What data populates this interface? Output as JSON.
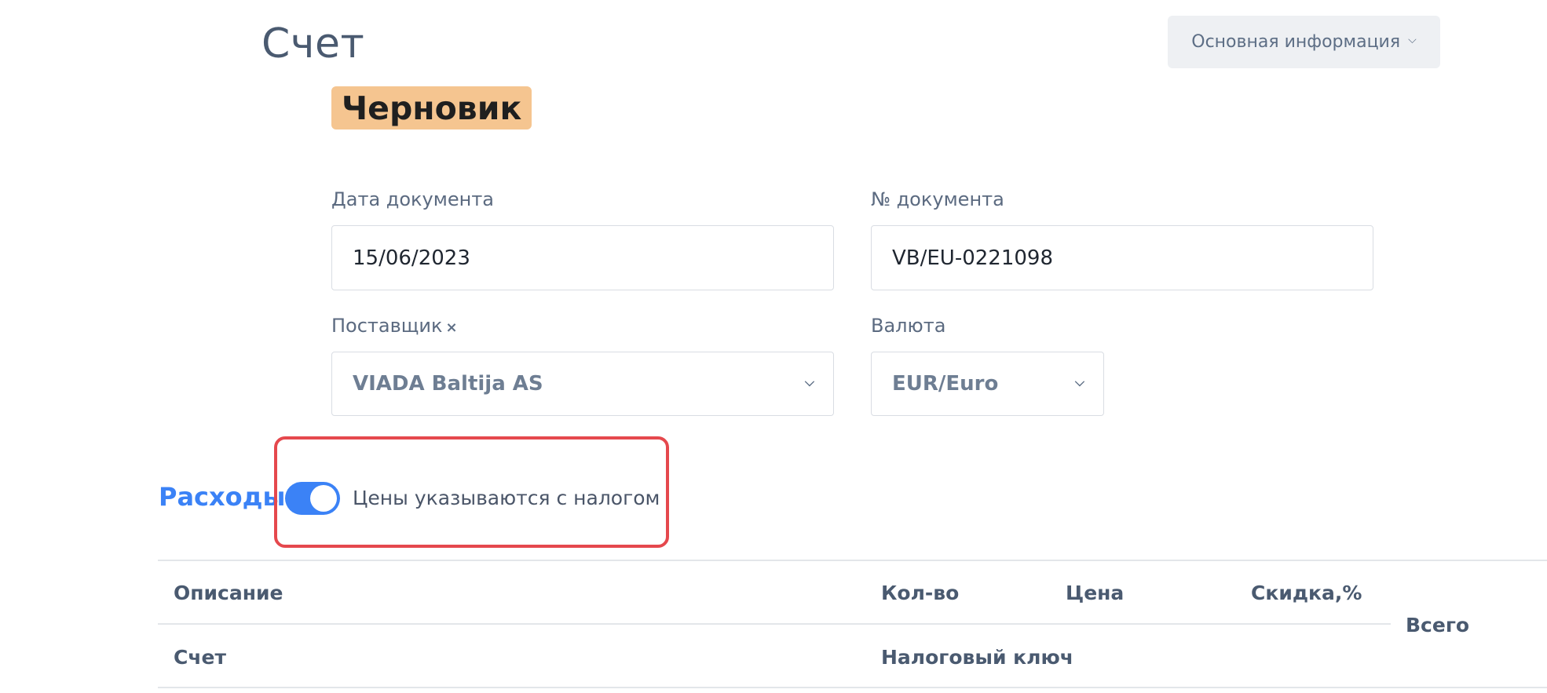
{
  "page": {
    "title": "Счет",
    "status_badge": "Черновик",
    "section_menu": {
      "label": "Основная информация",
      "icon": "chevron-down-icon"
    }
  },
  "form": {
    "document_date": {
      "label": "Дата документа",
      "value": "15/06/2023"
    },
    "document_number": {
      "label": "№ документа",
      "value": "VB/EU-0221098"
    },
    "supplier": {
      "label": "Поставщик",
      "clear_icon": "×",
      "value": "VIADA Baltija AS"
    },
    "currency": {
      "label": "Валюта",
      "value": "EUR/Euro"
    }
  },
  "expenses": {
    "section_title": "Расходы",
    "tax_inclusive_toggle": {
      "label": "Цены указываются с налогом",
      "checked": true
    },
    "table": {
      "headers_row1": [
        "Описание",
        "Кол-во",
        "Цена",
        "Скидка,%"
      ],
      "headers_row2": [
        "Счет",
        "Налоговый ключ"
      ],
      "total_header": "Всего"
    }
  },
  "colors": {
    "accent": "#3b82f6",
    "badge_bg": "#f5c590",
    "highlight": "#e5484d"
  }
}
